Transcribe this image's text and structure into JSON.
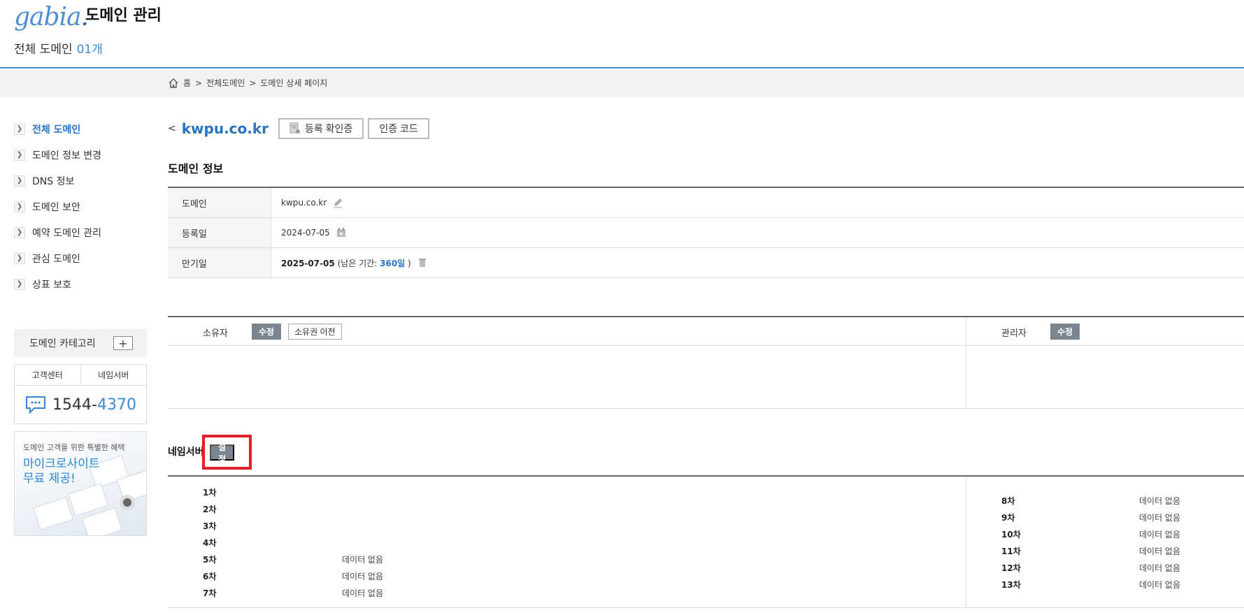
{
  "header": {
    "logo": "gabia",
    "title": "도메인 관리",
    "domain_count_label": "전체 도메인",
    "domain_count_value": "01개"
  },
  "breadcrumb": {
    "items": [
      "홈",
      ">",
      "전체도메인",
      ">",
      "도메인 상세 페이지"
    ]
  },
  "sidebar": {
    "items": [
      {
        "label": "전체 도메인",
        "active": true
      },
      {
        "label": "도메인 정보 변경"
      },
      {
        "label": "DNS 정보"
      },
      {
        "label": "도메인 보안"
      },
      {
        "label": "예약 도메인 관리"
      },
      {
        "label": "관심 도메인"
      },
      {
        "label": "상표 보호"
      }
    ],
    "category_label": "도메인 카테고리",
    "category_add": "+",
    "support_tabs": [
      "고객센터",
      "네임서버"
    ],
    "phone_prefix": "1544-",
    "phone_suffix": "4370",
    "promo_sub": "도메인 고객을 위한 특별한 혜택",
    "promo_title_1": "마이크로사이트",
    "promo_title_2": "무료 제공!"
  },
  "domain": {
    "back": "<",
    "name": "kwpu.co.kr",
    "cert_button": "등록 확인증",
    "auth_button": "인증 코드"
  },
  "info": {
    "section_title": "도메인 정보",
    "rows": [
      {
        "label": "도메인",
        "value": "kwpu.co.kr"
      },
      {
        "label": "등록일",
        "value": "2024-07-05"
      },
      {
        "label": "만기일",
        "value": "2025-07-05",
        "remain_prefix": "(남은 기간:",
        "remain_value": "360일",
        "remain_suffix": ")"
      }
    ]
  },
  "persons": {
    "owner_label": "소유자",
    "owner_edit": "수정",
    "owner_transfer": "소유권 이전",
    "admin_label": "관리자",
    "admin_edit": "수정"
  },
  "nameserver": {
    "title": "네임서버",
    "set_button": "설정",
    "left": [
      {
        "order": "1차",
        "value": ""
      },
      {
        "order": "2차",
        "value": ""
      },
      {
        "order": "3차",
        "value": ""
      },
      {
        "order": "4차",
        "value": ""
      },
      {
        "order": "5차",
        "value": "데이터 없음"
      },
      {
        "order": "6차",
        "value": "데이터 없음"
      },
      {
        "order": "7차",
        "value": "데이터 없음"
      }
    ],
    "right": [
      {
        "order": "8차",
        "value": "데이터 없음"
      },
      {
        "order": "9차",
        "value": "데이터 없음"
      },
      {
        "order": "10차",
        "value": "데이터 없음"
      },
      {
        "order": "11차",
        "value": "데이터 없음"
      },
      {
        "order": "12차",
        "value": "데이터 없음"
      },
      {
        "order": "13차",
        "value": "데이터 없음"
      }
    ]
  },
  "colors": {
    "accent": "#3a8ad1",
    "link": "#2a74c4",
    "highlight": "#e0202a",
    "button_dark": "#7a8590"
  }
}
